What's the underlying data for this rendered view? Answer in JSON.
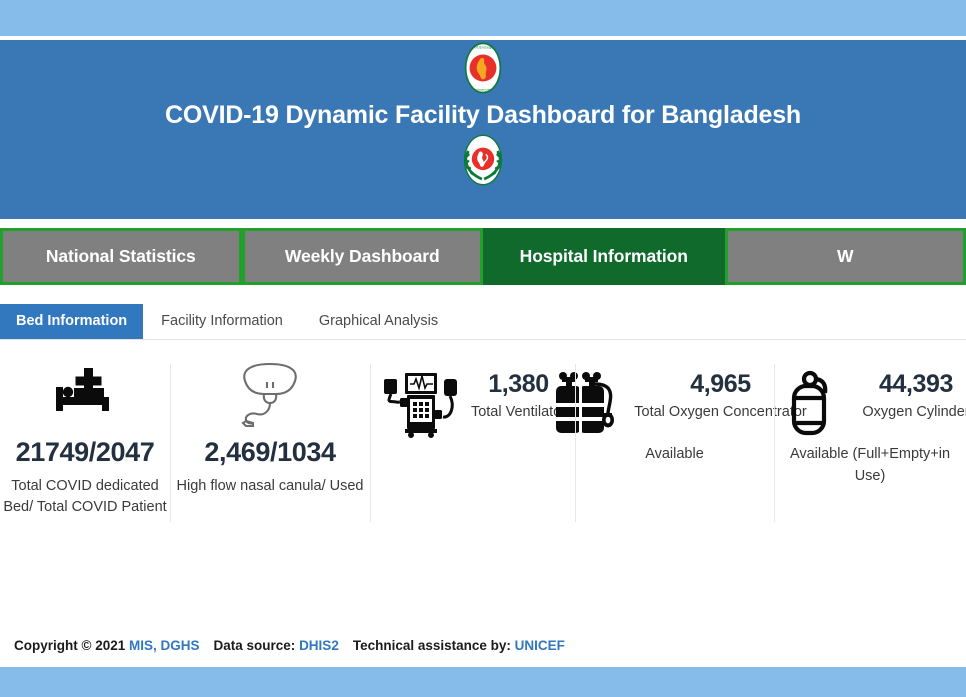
{
  "header": {
    "title": "COVID-19 Dynamic Facility Dashboard for Bangladesh",
    "top_emblem_name": "government-of-bangladesh-emblem",
    "bottom_emblem_name": "dghs-logo",
    "banner_color": "#3a78b5",
    "page_background": "#86bce9"
  },
  "main_nav": {
    "active_color": "#0f6a2c",
    "inactive_color": "#808080",
    "border_color": "#21a02b",
    "tabs": [
      {
        "label": "National Statistics",
        "active": false
      },
      {
        "label": "Weekly Dashboard",
        "active": false
      },
      {
        "label": "Hospital Information",
        "active": true
      },
      {
        "label": "W",
        "active": false
      }
    ]
  },
  "sub_nav": {
    "active_color": "#3178be",
    "tabs": [
      {
        "label": "Bed Information",
        "active": true
      },
      {
        "label": "Facility Information",
        "active": false
      },
      {
        "label": "Graphical Analysis",
        "active": false
      }
    ]
  },
  "stats": {
    "cards": [
      {
        "icon": "hospital-bed-plus-icon",
        "value": "21749/2047",
        "label": "Total COVID dedicated Bed/ Total COVID Patient",
        "layout": "stacked"
      },
      {
        "icon": "nasal-cannula-icon",
        "value": "2,469/1034",
        "label": "High flow nasal canula/ Used",
        "layout": "stacked"
      },
      {
        "icon": "ventilator-icon",
        "value": "1,380",
        "label": "Total Ventilator",
        "label_tail": "",
        "layout": "inline"
      },
      {
        "icon": "oxygen-concentrator-icon",
        "value": "4,965",
        "label": "Total Oxygen Concentrator",
        "label_tail": "Available",
        "layout": "inline"
      },
      {
        "icon": "oxygen-cylinder-icon",
        "value": "44,393",
        "label": "Oxygen Cylinder",
        "label_tail": "Available (Full+Empty+in Use)",
        "layout": "inline"
      }
    ]
  },
  "footer": {
    "copyright": "Copyright © 2021",
    "copyright_link": "MIS, DGHS",
    "data_source_label": "Data source:",
    "data_source_link": "DHIS2",
    "assistance_label": "Technical assistance by:",
    "assistance_link": "UNICEF",
    "link_color": "#3178be"
  }
}
